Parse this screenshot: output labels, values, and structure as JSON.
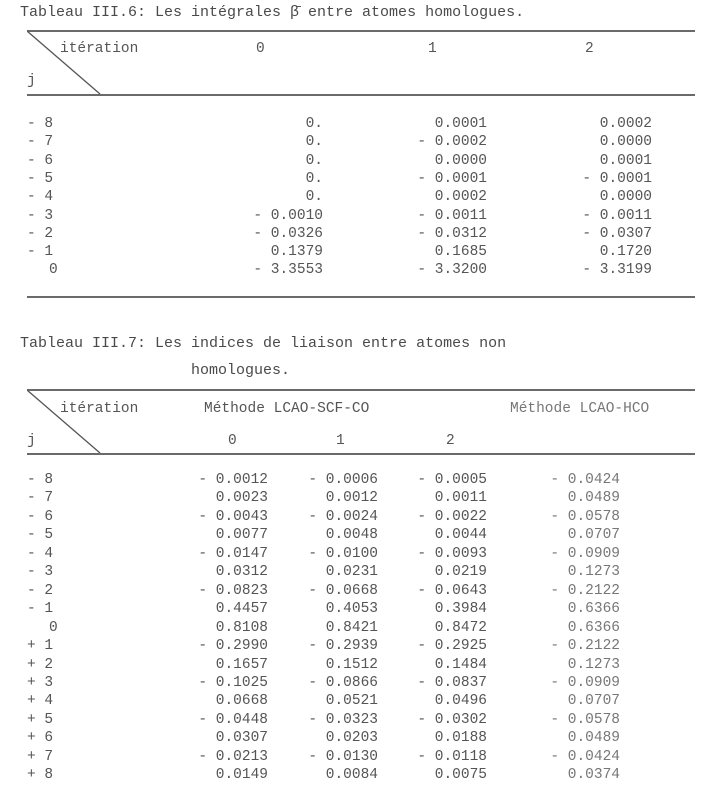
{
  "table1": {
    "caption": "Tableau III.6: Les intégrales β̄ entre atomes homologues.",
    "corner_top": "itération",
    "corner_bottom": "j",
    "columns": [
      "0",
      "1",
      "2"
    ],
    "rows": [
      {
        "j": "- 8",
        "v": [
          "0.",
          "0.0001",
          "0.0002"
        ]
      },
      {
        "j": "- 7",
        "v": [
          "0.",
          "- 0.0002",
          "0.0000"
        ]
      },
      {
        "j": "- 6",
        "v": [
          "0.",
          "0.0000",
          "0.0001"
        ]
      },
      {
        "j": "- 5",
        "v": [
          "0.",
          "- 0.0001",
          "- 0.0001"
        ]
      },
      {
        "j": "- 4",
        "v": [
          "0.",
          "0.0002",
          "0.0000"
        ]
      },
      {
        "j": "- 3",
        "v": [
          "- 0.0010",
          "- 0.0011",
          "- 0.0011"
        ]
      },
      {
        "j": "- 2",
        "v": [
          "- 0.0326",
          "- 0.0312",
          "- 0.0307"
        ]
      },
      {
        "j": "- 1",
        "v": [
          "0.1379",
          "0.1685",
          "0.1720"
        ]
      },
      {
        "j": "0",
        "v": [
          "- 3.3553",
          "- 3.3200",
          "- 3.3199"
        ]
      }
    ]
  },
  "table2": {
    "caption_line1": "Tableau III.7: Les indices de liaison entre atomes non",
    "caption_line2": "homologues.",
    "corner_top": "itération",
    "corner_bottom": "j",
    "group1": "Méthode LCAO-SCF-CO",
    "group2": "Méthode LCAO-HCO",
    "columns": [
      "0",
      "1",
      "2"
    ],
    "rows": [
      {
        "j": "- 8",
        "v": [
          "- 0.0012",
          "- 0.0006",
          "- 0.0005",
          "- 0.0424"
        ]
      },
      {
        "j": "- 7",
        "v": [
          "0.0023",
          "0.0012",
          "0.0011",
          "0.0489"
        ]
      },
      {
        "j": "- 6",
        "v": [
          "- 0.0043",
          "- 0.0024",
          "- 0.0022",
          "- 0.0578"
        ]
      },
      {
        "j": "- 5",
        "v": [
          "0.0077",
          "0.0048",
          "0.0044",
          "0.0707"
        ]
      },
      {
        "j": "- 4",
        "v": [
          "- 0.0147",
          "- 0.0100",
          "- 0.0093",
          "- 0.0909"
        ]
      },
      {
        "j": "- 3",
        "v": [
          "0.0312",
          "0.0231",
          "0.0219",
          "0.1273"
        ]
      },
      {
        "j": "- 2",
        "v": [
          "- 0.0823",
          "- 0.0668",
          "- 0.0643",
          "- 0.2122"
        ]
      },
      {
        "j": "- 1",
        "v": [
          "0.4457",
          "0.4053",
          "0.3984",
          "0.6366"
        ]
      },
      {
        "j": "0",
        "v": [
          "0.8108",
          "0.8421",
          "0.8472",
          "0.6366"
        ]
      },
      {
        "j": "+ 1",
        "v": [
          "- 0.2990",
          "- 0.2939",
          "- 0.2925",
          "- 0.2122"
        ]
      },
      {
        "j": "+ 2",
        "v": [
          "0.1657",
          "0.1512",
          "0.1484",
          "0.1273"
        ]
      },
      {
        "j": "+ 3",
        "v": [
          "- 0.1025",
          "- 0.0866",
          "- 0.0837",
          "- 0.0909"
        ]
      },
      {
        "j": "+ 4",
        "v": [
          "0.0668",
          "0.0521",
          "0.0496",
          "0.0707"
        ]
      },
      {
        "j": "+ 5",
        "v": [
          "- 0.0448",
          "- 0.0323",
          "- 0.0302",
          "- 0.0578"
        ]
      },
      {
        "j": "+ 6",
        "v": [
          "0.0307",
          "0.0203",
          "0.0188",
          "0.0489"
        ]
      },
      {
        "j": "+ 7",
        "v": [
          "- 0.0213",
          "- 0.0130",
          "- 0.0118",
          "- 0.0424"
        ]
      },
      {
        "j": "+ 8",
        "v": [
          "0.0149",
          "0.0084",
          "0.0075",
          "0.0374"
        ]
      }
    ]
  }
}
